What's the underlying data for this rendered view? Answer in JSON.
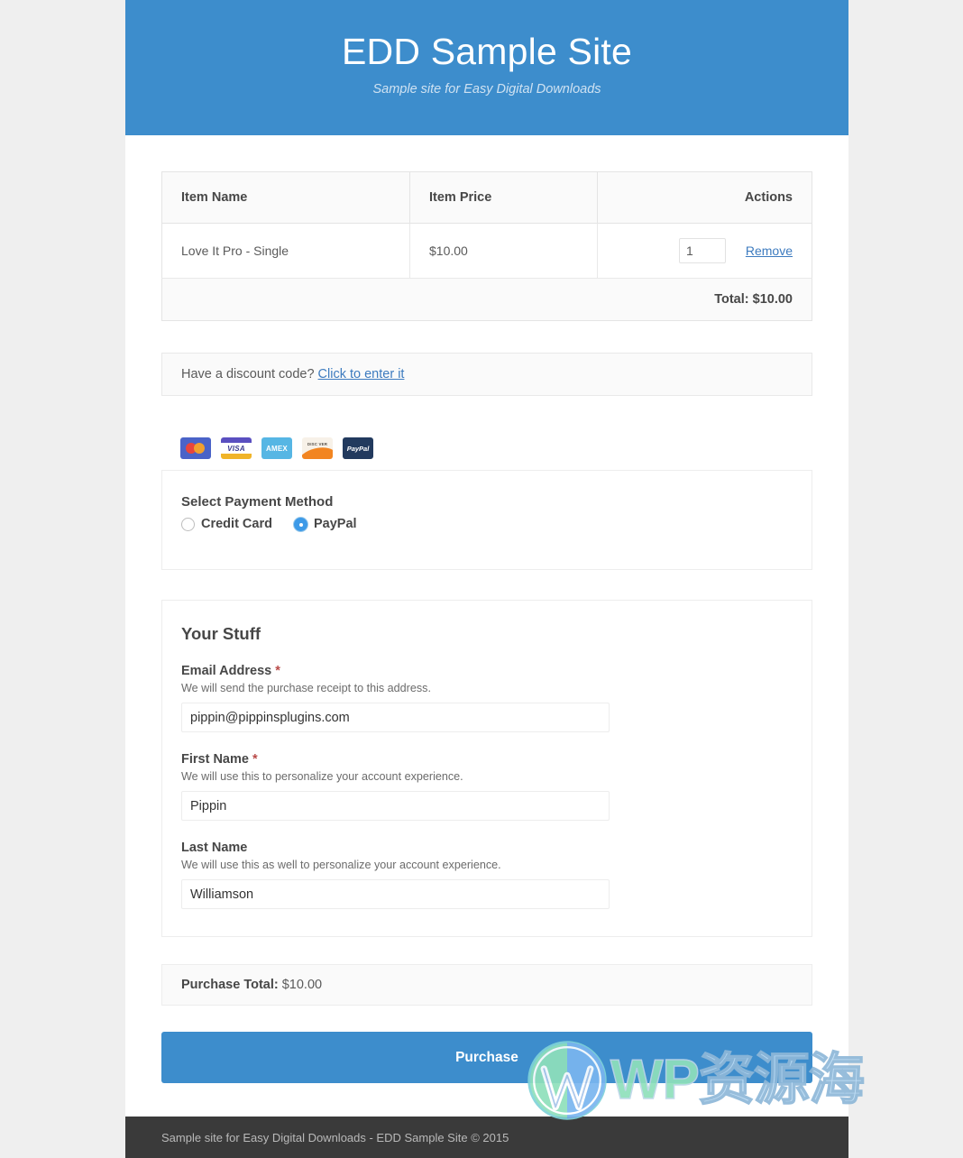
{
  "header": {
    "title": "EDD Sample Site",
    "description": "Sample site for Easy Digital Downloads"
  },
  "cart": {
    "columns": [
      "Item Name",
      "Item Price",
      "Actions"
    ],
    "rows": [
      {
        "name": "Love It Pro - Single",
        "price": "$10.00",
        "quantity": "1",
        "remove_label": "Remove"
      }
    ],
    "total_label": "Total:",
    "total_value": "$10.00"
  },
  "discount": {
    "prompt": "Have a discount code?",
    "link_label": "Click to enter it"
  },
  "card_icons": [
    {
      "name": "mastercard-icon",
      "label": ""
    },
    {
      "name": "visa-icon",
      "label": "VISA"
    },
    {
      "name": "amex-icon",
      "label": "AMEX"
    },
    {
      "name": "discover-icon",
      "label": "DISC VER"
    },
    {
      "name": "paypal-icon",
      "label": "PayPal"
    }
  ],
  "gateway": {
    "legend": "Select Payment Method",
    "options": [
      {
        "label": "Credit Card",
        "selected": false
      },
      {
        "label": "PayPal",
        "selected": true
      }
    ]
  },
  "personal_info": {
    "legend": "Your Stuff",
    "fields": [
      {
        "label": "Email Address",
        "required": "*",
        "description": "We will send the purchase receipt to this address.",
        "value": "pippin@pippinsplugins.com"
      },
      {
        "label": "First Name",
        "required": "*",
        "description": "We will use this to personalize your account experience.",
        "value": "Pippin"
      },
      {
        "label": "Last Name",
        "required": "",
        "description": "We will use this as well to personalize your account experience.",
        "value": "Williamson"
      }
    ]
  },
  "purchase": {
    "total_label": "Purchase Total:",
    "total_value": "$10.00",
    "button_label": "Purchase"
  },
  "footer": {
    "text": "Sample site for Easy Digital Downloads - EDD Sample Site © 2015"
  },
  "watermark": {
    "wp": "WP",
    "cn": "资源海"
  },
  "colors": {
    "brand_blue": "#3d8dcc",
    "link_blue": "#3d7bbf",
    "required_red": "#b94a48",
    "footer_dark": "#3a3a3a",
    "page_gray": "#efefef"
  }
}
